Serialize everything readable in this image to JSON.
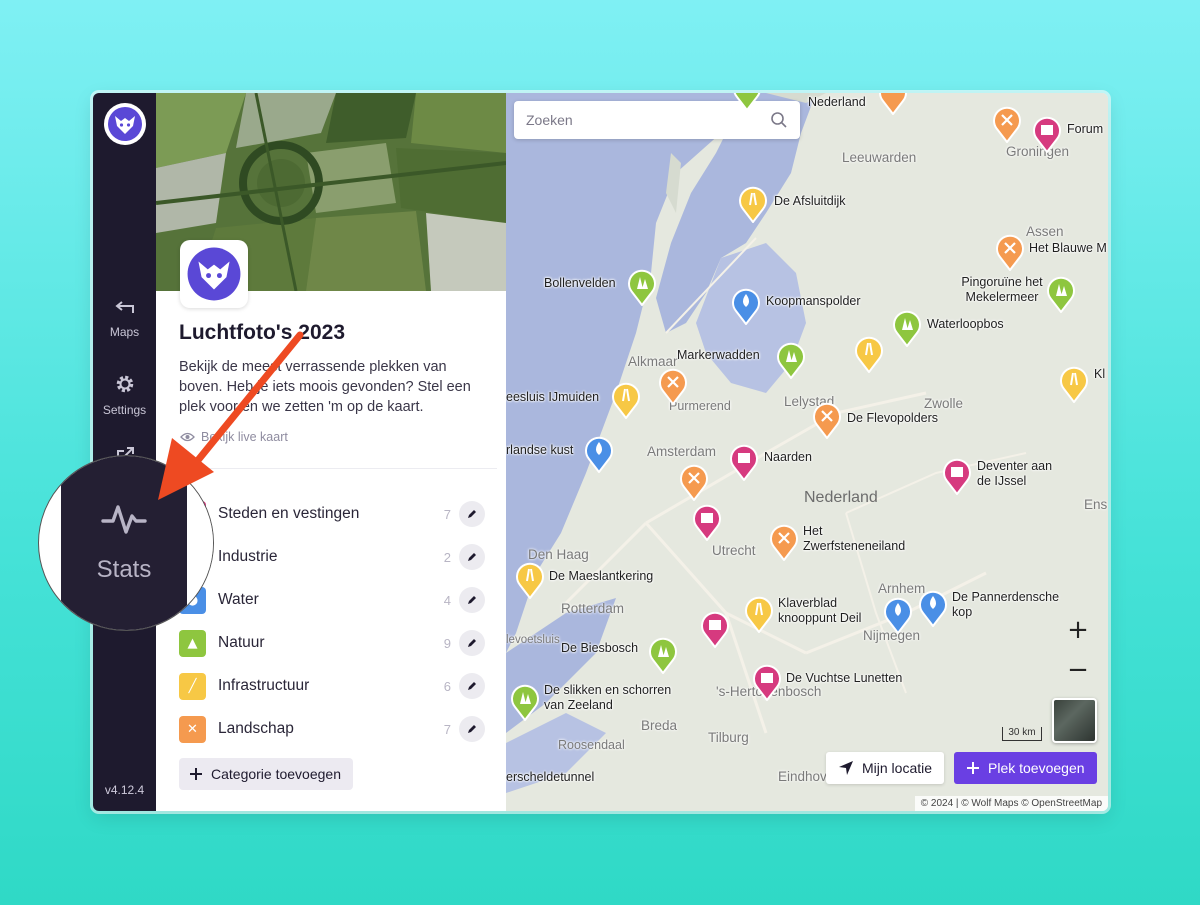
{
  "sidebar": {
    "items": [
      {
        "label": "Maps",
        "icon": "back-arrow-icon"
      },
      {
        "label": "Settings",
        "icon": "gear-icon"
      },
      {
        "label": "",
        "icon": "external-link-icon"
      }
    ],
    "version": "v4.12.4"
  },
  "callout": {
    "label": "Stats",
    "icon": "pulse-icon"
  },
  "panel": {
    "title": "Luchtfoto's 2023",
    "description": "Bekijk de meest verrassende plekken van boven. Heb je iets moois gevonden? Stel een plek voor en we zetten 'm op de kaart.",
    "live_link": "Bekijk live kaart",
    "categories": [
      {
        "label": "Steden en vestingen",
        "count": "7",
        "color": "#d63a7f",
        "icon": "castle-icon"
      },
      {
        "label": "Industrie",
        "count": "2",
        "color": "#8b5fd9",
        "icon": "factory-icon"
      },
      {
        "label": "Water",
        "count": "4",
        "color": "#4a8fe6",
        "icon": "drop-icon"
      },
      {
        "label": "Natuur",
        "count": "9",
        "color": "#8ec63f",
        "icon": "trees-icon"
      },
      {
        "label": "Infrastructuur",
        "count": "6",
        "color": "#f7c845",
        "icon": "road-icon"
      },
      {
        "label": "Landschap",
        "count": "7",
        "color": "#f59a4f",
        "icon": "windmill-icon"
      }
    ],
    "add_category": "Categorie toevoegen"
  },
  "map": {
    "search_placeholder": "Zoeken",
    "places": {
      "nederland_top": "Nederland",
      "forum": "Forum",
      "groningen": "Groningen",
      "leeuwarden": "Leeuwarden",
      "afsluitdijk": "De Afsluitdijk",
      "assen": "Assen",
      "blauwe": "Het Blauwe M",
      "bollenvelden": "Bollenvelden",
      "koopmanspolder": "Koopmanspolder",
      "pingoruine": "Pingoruïne het Mekelermeer",
      "waterloopbos": "Waterloopbos",
      "alkmaar": "Alkmaar",
      "markerwadden": "Markerwadden",
      "sluis": "eesluis IJmuiden",
      "purmerend": "Purmerend",
      "lelystad": "Lelystad",
      "zwolle": "Zwolle",
      "kl": "Kl",
      "flevopolders": "De Flevopolders",
      "kust": "rlandse kust",
      "amsterdam": "Amsterdam",
      "naarden": "Naarden",
      "deventer": "Deventer aan de IJssel",
      "nederland_mid": "Nederland",
      "ens": "Ens",
      "zwerf": "Het Zwerfsteneneiland",
      "denhaag": "Den Haag",
      "utrecht": "Utrecht",
      "maeslant": "De Maeslantkering",
      "arnhem": "Arnhem",
      "pannerdensche": "De Pannerdensche kop",
      "rotterdam": "Rotterdam",
      "klaverblad": "Klaverblad knooppunt Deil",
      "voetsluis": "levoetsluis",
      "nijmegen": "Nijmegen",
      "biesbosch": "De Biesbosch",
      "vuchtse": "De Vuchtse Lunetten",
      "slikken": "De slikken en schorren van Zeeland",
      "shertogenbosch": "'s-Hertogenbosch",
      "breda": "Breda",
      "roosendaal": "Roosendaal",
      "tilburg": "Tilburg",
      "westerschelde": "erscheldetunnel",
      "eindhoven": "Eindhov"
    },
    "zoom_in": "+",
    "zoom_out": "−",
    "scale": "30 km",
    "my_location": "Mijn locatie",
    "add_place": "Plek toevoegen",
    "attribution": "© 2024 | © Wolf Maps © OpenStreetMap"
  }
}
